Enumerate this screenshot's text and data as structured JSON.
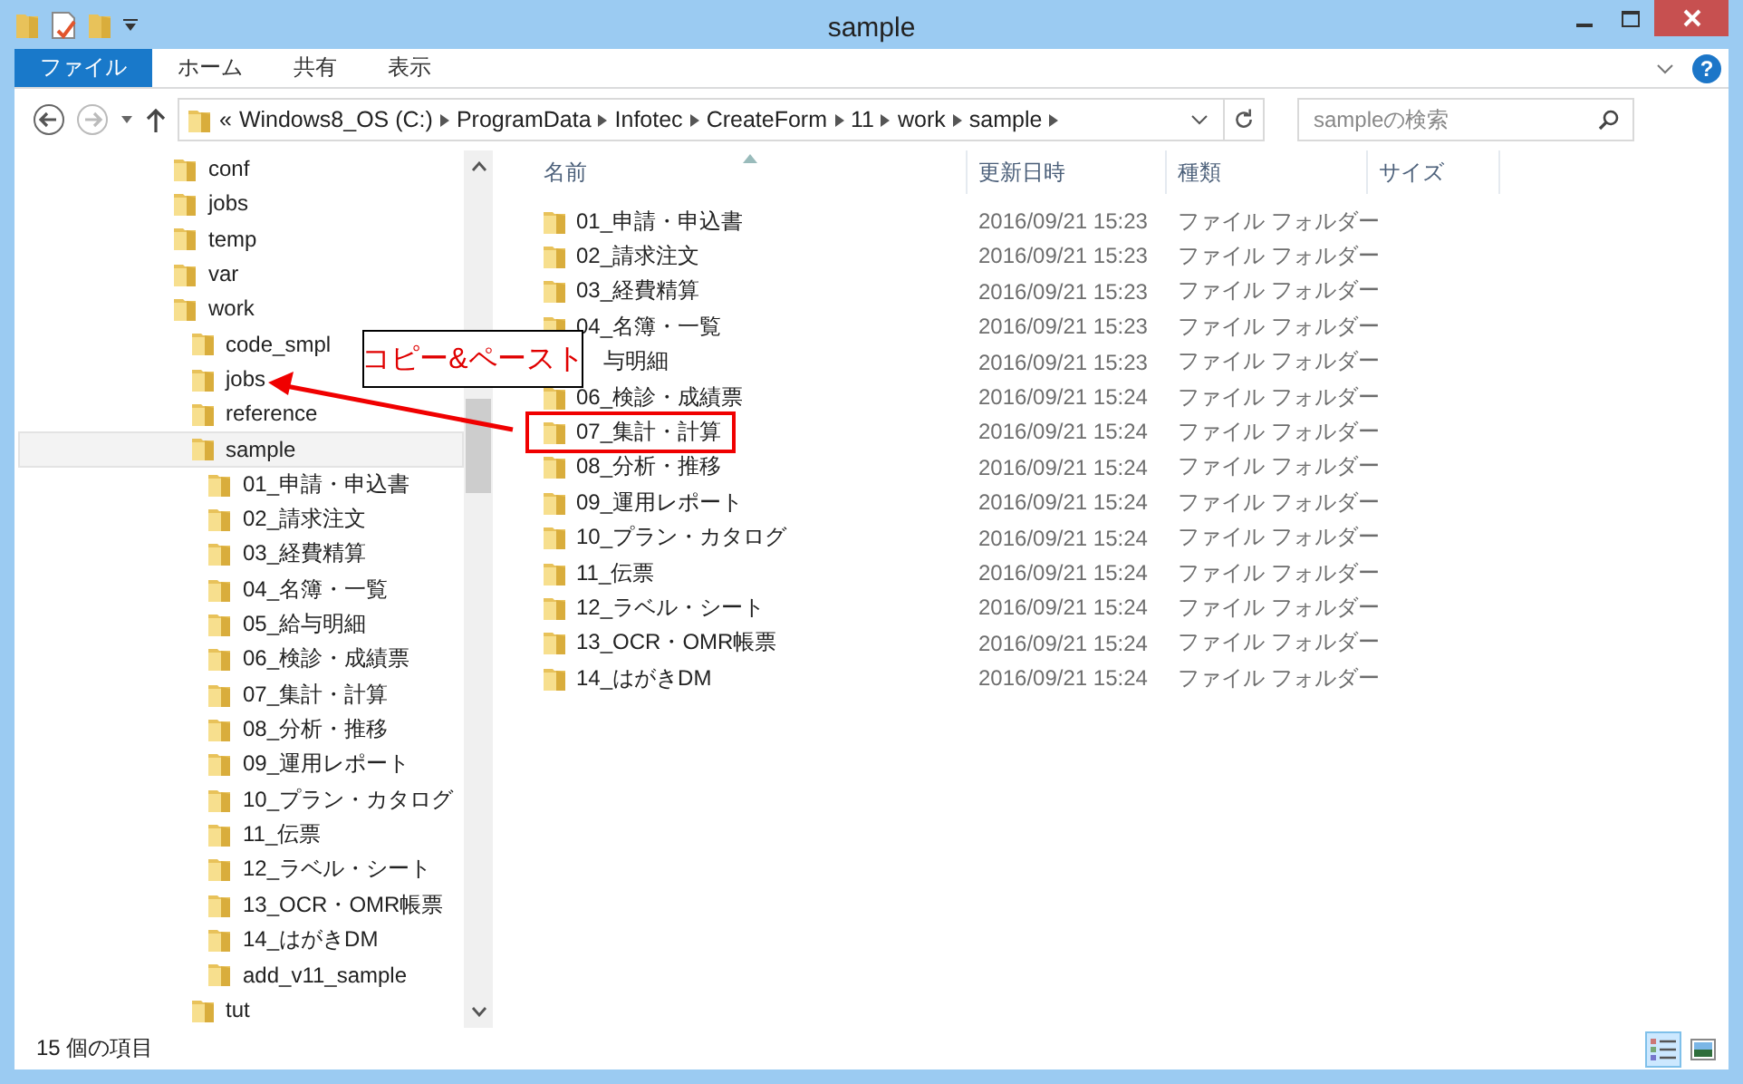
{
  "window": {
    "title": "sample"
  },
  "ribbon_tabs": [
    {
      "label": "ファイル",
      "selected": true
    },
    {
      "label": "ホーム",
      "selected": false
    },
    {
      "label": "共有",
      "selected": false
    },
    {
      "label": "表示",
      "selected": false
    }
  ],
  "help": "?",
  "address": {
    "overflow": "«",
    "crumbs": [
      "Windows8_OS (C:)",
      "ProgramData",
      "Infotec",
      "CreateForm",
      "11",
      "work",
      "sample"
    ]
  },
  "search": {
    "placeholder": "sampleの検索"
  },
  "tree": [
    {
      "label": "conf",
      "selected": false
    },
    {
      "label": "jobs",
      "selected": false
    },
    {
      "label": "temp",
      "selected": false
    },
    {
      "label": "var",
      "selected": false
    },
    {
      "label": "work",
      "selected": false,
      "children": [
        {
          "label": "code_smpl",
          "selected": false
        },
        {
          "label": "jobs",
          "selected": false
        },
        {
          "label": "reference",
          "selected": false
        },
        {
          "label": "sample",
          "selected": true,
          "children": [
            {
              "label": "01_申請・申込書",
              "selected": false
            },
            {
              "label": "02_請求注文",
              "selected": false
            },
            {
              "label": "03_経費精算",
              "selected": false
            },
            {
              "label": "04_名簿・一覧",
              "selected": false
            },
            {
              "label": "05_給与明細",
              "selected": false
            },
            {
              "label": "06_検診・成績票",
              "selected": false
            },
            {
              "label": "07_集計・計算",
              "selected": false
            },
            {
              "label": "08_分析・推移",
              "selected": false
            },
            {
              "label": "09_運用レポート",
              "selected": false
            },
            {
              "label": "10_プラン・カタログ",
              "selected": false
            },
            {
              "label": "11_伝票",
              "selected": false
            },
            {
              "label": "12_ラベル・シート",
              "selected": false
            },
            {
              "label": "13_OCR・OMR帳票",
              "selected": false
            },
            {
              "label": "14_はがきDM",
              "selected": false
            },
            {
              "label": "add_v11_sample",
              "selected": false
            }
          ]
        },
        {
          "label": "tut",
          "selected": false
        }
      ]
    }
  ],
  "table": {
    "columns": [
      "名前",
      "更新日時",
      "種類",
      "サイズ"
    ],
    "rows": [
      {
        "name": "01_申請・申込書",
        "date": "2016/09/21 15:23",
        "type": "ファイル フォルダー",
        "highlighted": false
      },
      {
        "name": "02_請求注文",
        "date": "2016/09/21 15:23",
        "type": "ファイル フォルダー",
        "highlighted": false
      },
      {
        "name": "03_経費精算",
        "date": "2016/09/21 15:23",
        "type": "ファイル フォルダー",
        "highlighted": false
      },
      {
        "name": "04_名簿・一覧",
        "date": "2016/09/21 15:23",
        "type": "ファイル フォルダー",
        "highlighted": false
      },
      {
        "name": "与明細",
        "date": "2016/09/21 15:23",
        "type": "ファイル フォルダー",
        "highlighted": false,
        "partly_hidden": true
      },
      {
        "name": "06_検診・成績票",
        "date": "2016/09/21 15:24",
        "type": "ファイル フォルダー",
        "highlighted": false
      },
      {
        "name": "07_集計・計算",
        "date": "2016/09/21 15:24",
        "type": "ファイル フォルダー",
        "highlighted": true
      },
      {
        "name": "08_分析・推移",
        "date": "2016/09/21 15:24",
        "type": "ファイル フォルダー",
        "highlighted": false
      },
      {
        "name": "09_運用レポート",
        "date": "2016/09/21 15:24",
        "type": "ファイル フォルダー",
        "highlighted": false
      },
      {
        "name": "10_プラン・カタログ",
        "date": "2016/09/21 15:24",
        "type": "ファイル フォルダー",
        "highlighted": false
      },
      {
        "name": "11_伝票",
        "date": "2016/09/21 15:24",
        "type": "ファイル フォルダー",
        "highlighted": false
      },
      {
        "name": "12_ラベル・シート",
        "date": "2016/09/21 15:24",
        "type": "ファイル フォルダー",
        "highlighted": false
      },
      {
        "name": "13_OCR・OMR帳票",
        "date": "2016/09/21 15:24",
        "type": "ファイル フォルダー",
        "highlighted": false
      },
      {
        "name": "14_はがきDM",
        "date": "2016/09/21 15:24",
        "type": "ファイル フォルダー",
        "highlighted": false
      }
    ]
  },
  "callout": {
    "text": "コピー&ペースト"
  },
  "status_bar": {
    "count": "15 個の項目"
  },
  "views": [
    {
      "kind": "details",
      "selected": true
    },
    {
      "kind": "large-icons",
      "selected": false
    }
  ]
}
